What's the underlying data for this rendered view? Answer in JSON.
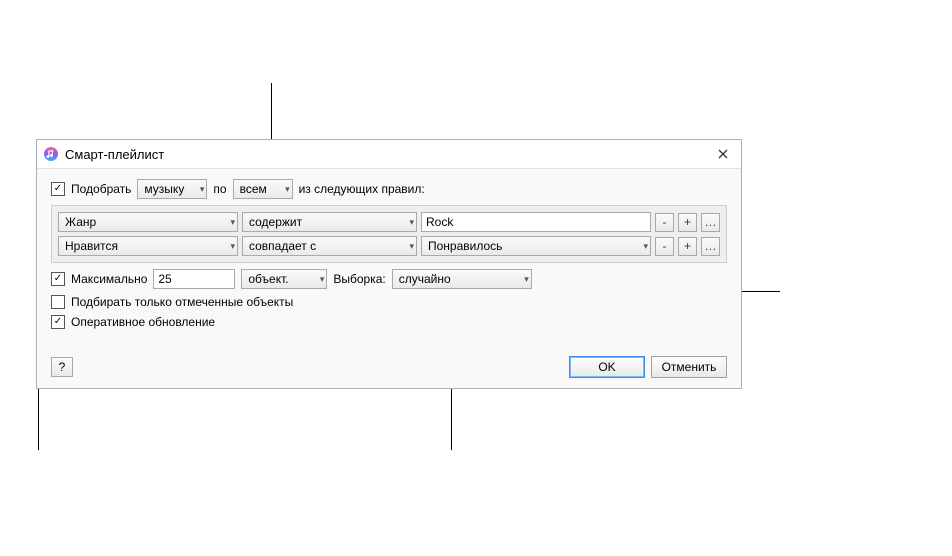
{
  "window": {
    "title": "Смарт-плейлист"
  },
  "match": {
    "checkbox_checked": true,
    "label": "Подобрать",
    "type_value": "музыку",
    "by_label": "по",
    "scope_value": "всем",
    "suffix": "из следующих правил:"
  },
  "rules": [
    {
      "field": "Жанр",
      "op": "содержит",
      "value": "Rock",
      "value_is_select": false
    },
    {
      "field": "Нравится",
      "op": "совпадает с",
      "value": "Понравилось",
      "value_is_select": true
    }
  ],
  "buttons": {
    "minus": "-",
    "plus": "+",
    "ellipsis": "…"
  },
  "limit": {
    "checked": true,
    "label": "Максимально",
    "value": "25",
    "unit": "объект.",
    "selection_label": "Выборка:",
    "selection_value": "случайно"
  },
  "checked_only": {
    "checked": false,
    "label": "Подбирать только отмеченные объекты"
  },
  "live_update": {
    "checked": true,
    "label": "Оперативное обновление"
  },
  "footer": {
    "help": "?",
    "ok": "OK",
    "cancel": "Отменить"
  }
}
